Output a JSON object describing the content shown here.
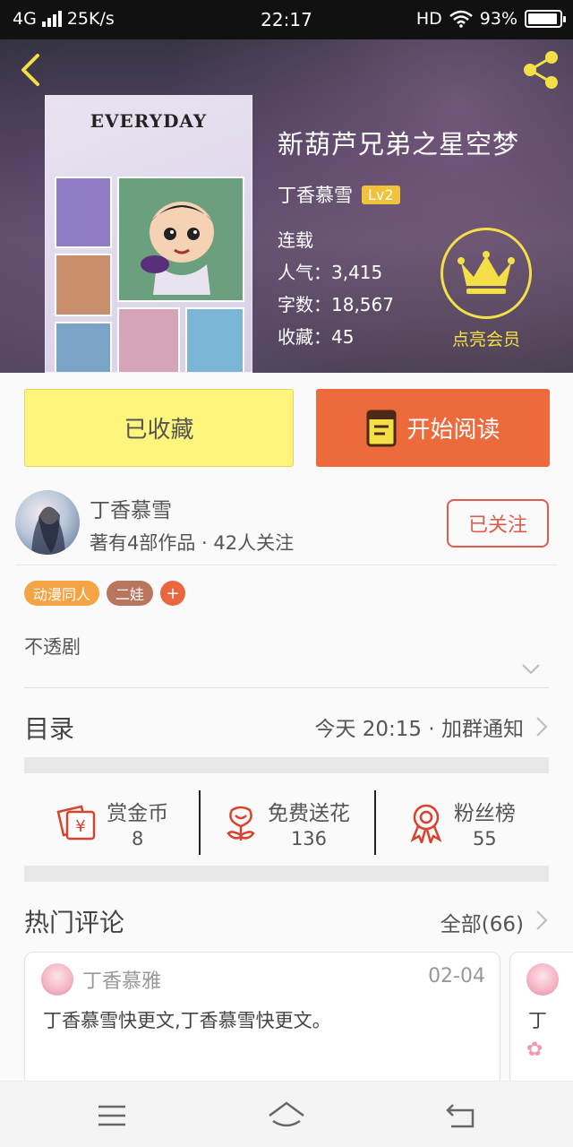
{
  "status_bar": {
    "network": "4G",
    "speed": "25K/s",
    "time": "22:17",
    "hd": "HD",
    "battery": "93%",
    "battery_level": 0.93
  },
  "book": {
    "cover_title": "EVERYDAY",
    "title": "新葫芦兄弟之星空梦",
    "author": "丁香慕雪",
    "level": "Lv2",
    "status": "连载",
    "popularity": "人气：3,415",
    "word_count": "字数：18,567",
    "favorites": "收藏：45"
  },
  "vip": {
    "label": "点亮会员"
  },
  "actions": {
    "collected_label": "已收藏",
    "read_label": "开始阅读"
  },
  "author_card": {
    "name": "丁香慕雪",
    "stats": "著有4部作品 · 42人关注",
    "follow_label": "已关注"
  },
  "tags": [
    {
      "label": "动漫同人",
      "color": "#f5a445"
    },
    {
      "label": "二娃",
      "color": "#b9765e"
    }
  ],
  "tag_add": "+",
  "intro": "不透剧",
  "toc": {
    "title": "目录",
    "update": "今天 20:15 · 加群通知"
  },
  "stats": [
    {
      "label": "赏金币",
      "value": "8",
      "icon": "coin-envelope-icon"
    },
    {
      "label": "免费送花",
      "value": "136",
      "icon": "flower-icon"
    },
    {
      "label": "粉丝榜",
      "value": "55",
      "icon": "ribbon-medal-icon"
    }
  ],
  "comments": {
    "title": "热门评论",
    "all_label": "全部(66)",
    "items": [
      {
        "user": "丁香慕雅",
        "date": "02-04",
        "text": "丁香慕雪快更文,丁香慕雪快更文。"
      },
      {
        "text_partial": "丁"
      }
    ]
  },
  "colors": {
    "accent_orange": "#ec6a3c",
    "collected_yellow": "#fdf57c",
    "vip_yellow": "#f4e046",
    "follow_red": "#e05a4e"
  }
}
